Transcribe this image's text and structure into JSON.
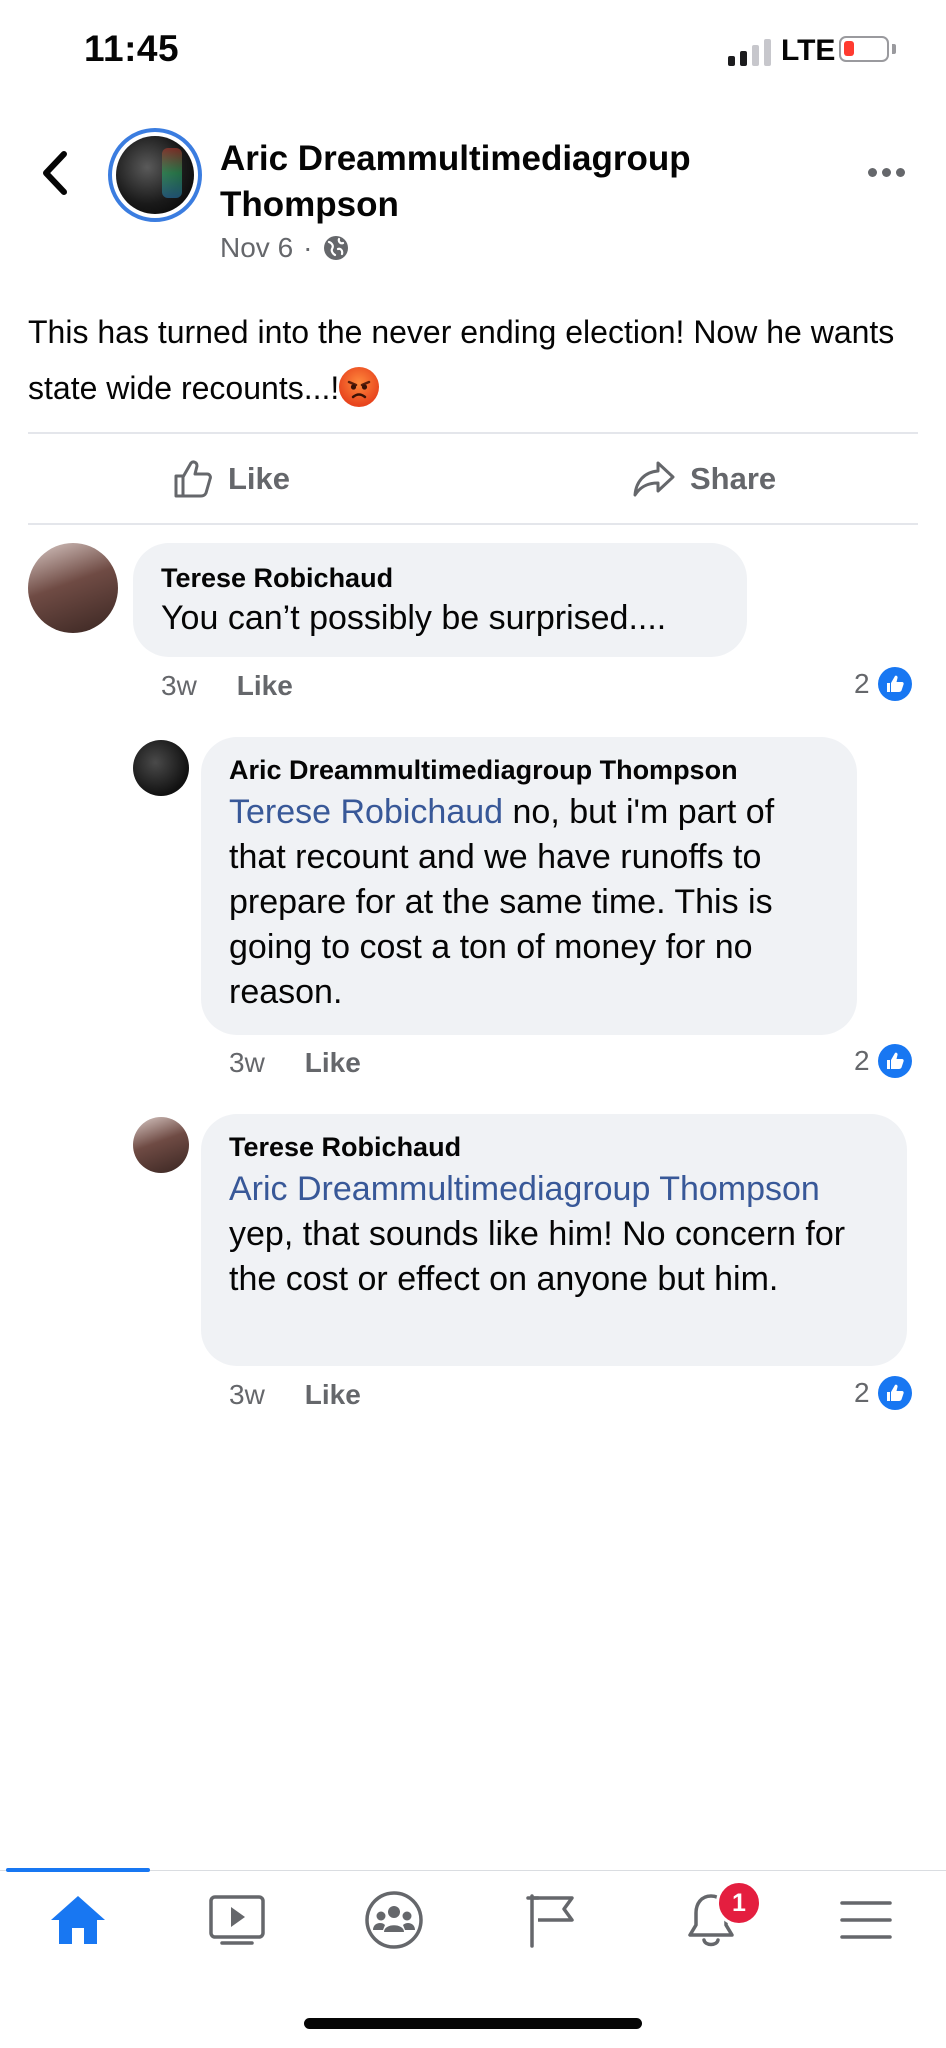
{
  "status_bar": {
    "time": "11:45",
    "network": "LTE"
  },
  "post": {
    "author": "Aric Dreammultimediagroup Thompson",
    "date": "Nov 6",
    "separator": "·",
    "text": "This has turned into the never ending election! Now he wants state wide recounts...!",
    "emoji": "angry-face",
    "actions": {
      "like": "Like",
      "share": "Share"
    }
  },
  "comments": [
    {
      "author": "Terese Robichaud",
      "mention": "",
      "text": "You can’t possibly be surprised....",
      "time": "3w",
      "like_label": "Like",
      "reactions": "2"
    },
    {
      "author": "Aric Dreammultimediagroup Thompson",
      "mention": "Terese Robichaud",
      "text": "no, but i'm part of that recount and we have runoffs to prepare for at the same time. This is going to cost a ton of money for no reason.",
      "time": "3w",
      "like_label": "Like",
      "reactions": "2"
    },
    {
      "author": "Terese Robichaud",
      "mention": "Aric Dreammultimediagroup Thompson",
      "text": "yep, that sounds like him! No concern for the cost or effect on anyone but him.",
      "time": "3w",
      "like_label": "Like",
      "reactions": "2"
    }
  ],
  "bottom_nav": {
    "items": [
      "home-icon",
      "video-icon",
      "groups-icon",
      "pages-flag-icon",
      "notifications-bell-icon",
      "menu-icon"
    ],
    "active": "home-icon",
    "notification_count": "1"
  },
  "colors": {
    "accent": "#1877f2",
    "mention": "#385898",
    "bubble": "#f0f2f5",
    "badge": "#e41e3f"
  }
}
